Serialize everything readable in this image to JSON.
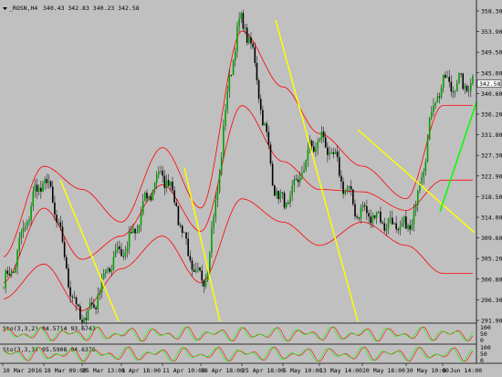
{
  "header": {
    "symbol_label": "_ROSN,H4",
    "ohlc_text": "340.43 342.83 340.23 342.58"
  },
  "price_axis": {
    "ticks": [
      "358.30",
      "353.90",
      "349.50",
      "345.00",
      "340.60",
      "336.20",
      "331.80",
      "327.30",
      "322.90",
      "318.50",
      "314.00",
      "309.60",
      "305.20",
      "300.80",
      "296.30",
      "291.90"
    ],
    "current_price": "342.58"
  },
  "time_axis": {
    "labels": [
      "10 Mar 2016",
      "18 Mar 09:00",
      "25 Mar 13:00",
      "1 Apr 18:00",
      "11 Apr 10:00",
      "18 Apr 18:00",
      "25 Apr 18:00",
      "5 May 10:00",
      "13 May 14:00",
      "20 May 18:00",
      "30 May 10:00",
      "6 Jun 14:00"
    ]
  },
  "sub_panels": [
    {
      "label": "Sto(3,3,2) 94.5714 93.6743",
      "scale": [
        "100",
        "50",
        "0"
      ]
    },
    {
      "label": "Sto(3,3,3) 95.5908 94.6376",
      "scale": [
        "100",
        "50",
        "0"
      ]
    }
  ],
  "colors": {
    "background": "#c0c0c0",
    "bull_candle": "#00a000",
    "bear_candle": "#000000",
    "bollinger": "#ff0000",
    "trendline_down": "#ffff00",
    "trendline_up": "#00ff00",
    "stoch_main": "#ff0000",
    "stoch_signal": "#00ff00"
  },
  "chart_data": {
    "type": "candlestick",
    "indicators": [
      "Bollinger Bands",
      "Stochastic (3,3,2)",
      "Stochastic (3,3,3)"
    ],
    "ylim": [
      289.6,
      360.5
    ],
    "x": [
      "10 Mar 2016",
      "18 Mar 09:00",
      "25 Mar 13:00",
      "1 Apr 18:00",
      "11 Apr 10:00",
      "18 Apr 18:00",
      "25 Apr 18:00",
      "5 May 10:00",
      "13 May 14:00",
      "20 May 18:00",
      "30 May 10:00",
      "6 Jun 14:00"
    ],
    "close_approx": [
      300.0,
      321.5,
      292.5,
      307.0,
      323.0,
      300.5,
      355.5,
      317.0,
      330.5,
      315.0,
      311.5,
      342.58
    ],
    "bollinger_upper_approx": [
      305.5,
      325.0,
      320.0,
      313.0,
      329.0,
      316.0,
      354.0,
      342.0,
      332.0,
      325.0,
      318.0,
      338.0
    ],
    "bollinger_middle_approx": [
      300.0,
      316.0,
      305.0,
      310.0,
      321.0,
      311.0,
      338.0,
      326.0,
      320.0,
      319.5,
      315.5,
      322.0
    ],
    "bollinger_lower_approx": [
      296.5,
      304.0,
      294.0,
      303.0,
      310.0,
      300.0,
      318.0,
      313.0,
      308.0,
      313.0,
      308.0,
      302.0
    ]
  }
}
